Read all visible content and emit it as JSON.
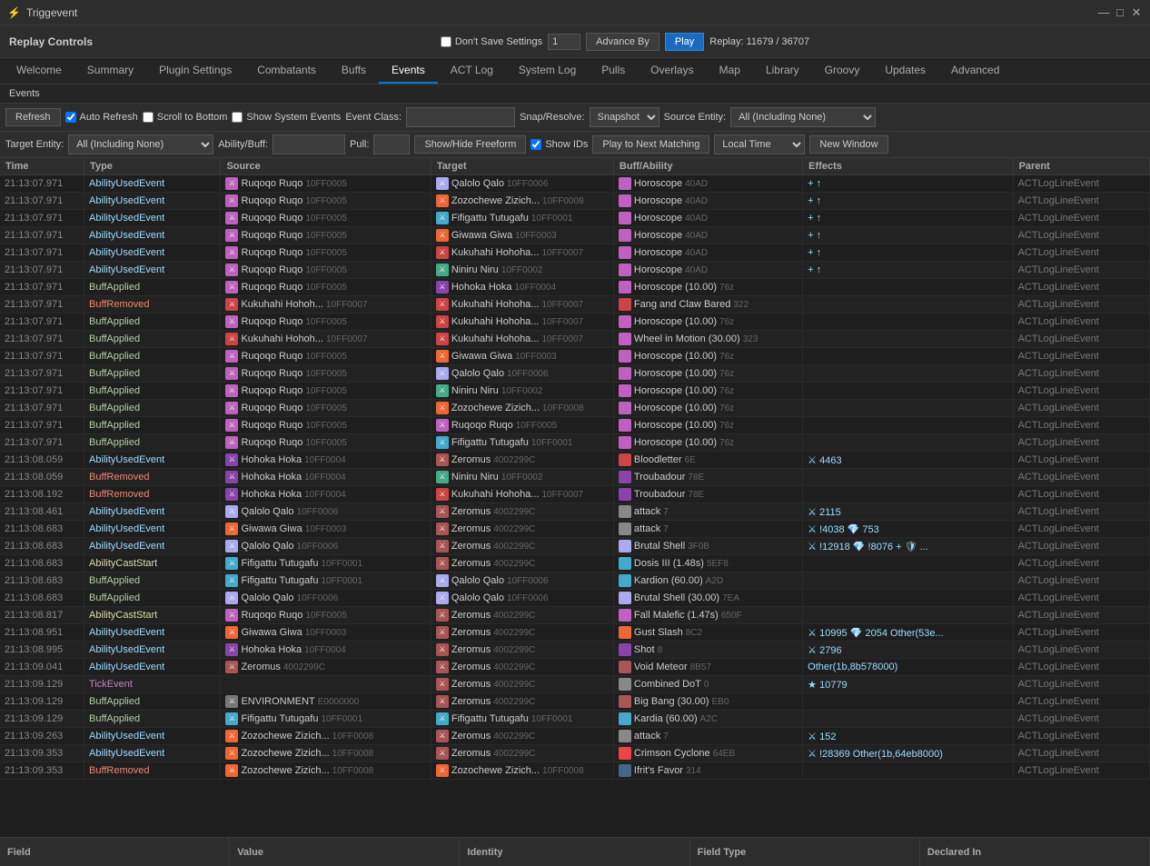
{
  "window": {
    "title": "Triggevent",
    "controls": [
      "—",
      "□",
      "✕"
    ]
  },
  "replay": {
    "title": "Replay Controls",
    "dont_save": "Don't Save Settings",
    "advance_by_label": "Advance By",
    "advance_by_value": "1",
    "play_label": "Play",
    "replay_info": "Replay: 11679 / 36707"
  },
  "nav_tabs": [
    "Welcome",
    "Summary",
    "Plugin Settings",
    "Combatants",
    "Buffs",
    "Events",
    "ACT Log",
    "System Log",
    "Pulls",
    "Overlays",
    "Map",
    "Library",
    "Groovy",
    "Updates",
    "Advanced"
  ],
  "active_tab": "Events",
  "section": "Events",
  "toolbar1": {
    "refresh_label": "Refresh",
    "auto_refresh_label": "Auto Refresh",
    "scroll_bottom_label": "Scroll to Bottom",
    "show_system_label": "Show System Events",
    "event_class_label": "Event Class:",
    "snap_resolve_label": "Snap/Resolve:",
    "snap_option": "Snapshot",
    "source_entity_label": "Source Entity:",
    "source_option": "All (Including None)"
  },
  "toolbar2": {
    "target_entity_label": "Target Entity:",
    "target_option": "All (Including None)",
    "ability_buff_label": "Ability/Buff:",
    "pull_label": "Pull:",
    "show_hide_freeform": "Show/Hide Freeform",
    "show_ids_label": "Show IDs",
    "play_next_label": "Play to Next Matching",
    "local_time_label": "Local Time",
    "new_window_label": "New Window"
  },
  "table": {
    "headers": [
      "Time",
      "Type",
      "Source",
      "Target",
      "Buff/Ability",
      "Effects",
      "Parent"
    ],
    "rows": [
      {
        "time": "21:13:07.971",
        "type": "AbilityUsedEvent",
        "type_class": "type-ability",
        "source": "Ruqoqo Ruqo",
        "source_id": "10FF0005",
        "target": "Qalolo Qalo",
        "target_id": "10FF0006",
        "buff": "Horoscope",
        "buff_id": "40AD",
        "effects": "+ ↑",
        "parent": "ACTLogLineEvent"
      },
      {
        "time": "21:13:07.971",
        "type": "AbilityUsedEvent",
        "type_class": "type-ability",
        "source": "Ruqoqo Ruqo",
        "source_id": "10FF0005",
        "target": "Zozochewe Zizich...",
        "target_id": "10FF0008",
        "buff": "Horoscope",
        "buff_id": "40AD",
        "effects": "+ ↑",
        "parent": "ACTLogLineEvent"
      },
      {
        "time": "21:13:07.971",
        "type": "AbilityUsedEvent",
        "type_class": "type-ability",
        "source": "Ruqoqo Ruqo",
        "source_id": "10FF0005",
        "target": "Fifigattu Tutugafu",
        "target_id": "10FF0001",
        "buff": "Horoscope",
        "buff_id": "40AD",
        "effects": "+ ↑",
        "parent": "ACTLogLineEvent"
      },
      {
        "time": "21:13:07.971",
        "type": "AbilityUsedEvent",
        "type_class": "type-ability",
        "source": "Ruqoqo Ruqo",
        "source_id": "10FF0005",
        "target": "Giwawa Giwa",
        "target_id": "10FF0003",
        "buff": "Horoscope",
        "buff_id": "40AD",
        "effects": "+ ↑",
        "parent": "ACTLogLineEvent"
      },
      {
        "time": "21:13:07.971",
        "type": "AbilityUsedEvent",
        "type_class": "type-ability",
        "source": "Ruqoqo Ruqo",
        "source_id": "10FF0005",
        "target": "Kukuhahi Hohoha...",
        "target_id": "10FF0007",
        "buff": "Horoscope",
        "buff_id": "40AD",
        "effects": "+ ↑",
        "parent": "ACTLogLineEvent"
      },
      {
        "time": "21:13:07.971",
        "type": "AbilityUsedEvent",
        "type_class": "type-ability",
        "source": "Ruqoqo Ruqo",
        "source_id": "10FF0005",
        "target": "Niniru Niru",
        "target_id": "10FF0002",
        "buff": "Horoscope",
        "buff_id": "40AD",
        "effects": "+ ↑",
        "parent": "ACTLogLineEvent"
      },
      {
        "time": "21:13:07.971",
        "type": "BuffApplied",
        "type_class": "type-buff-applied",
        "source": "Ruqoqo Ruqo",
        "source_id": "10FF0005",
        "target": "Hohoka Hoka",
        "target_id": "10FF0004",
        "buff": "Horoscope (10.00)",
        "buff_id": "76z",
        "effects": "",
        "parent": "ACTLogLineEvent"
      },
      {
        "time": "21:13:07.971",
        "type": "BuffRemoved",
        "type_class": "type-buff-removed",
        "source": "Kukuhahi Hohoh...",
        "source_id": "10FF0007",
        "target": "Kukuhahi Hohoha...",
        "target_id": "10FF0007",
        "buff": "Fang and Claw Bared",
        "buff_id": "322",
        "effects": "",
        "parent": "ACTLogLineEvent"
      },
      {
        "time": "21:13:07.971",
        "type": "BuffApplied",
        "type_class": "type-buff-applied",
        "source": "Ruqoqo Ruqo",
        "source_id": "10FF0005",
        "target": "Kukuhahi Hohoha...",
        "target_id": "10FF0007",
        "buff": "Horoscope (10.00)",
        "buff_id": "76z",
        "effects": "",
        "parent": "ACTLogLineEvent"
      },
      {
        "time": "21:13:07.971",
        "type": "BuffApplied",
        "type_class": "type-buff-applied",
        "source": "Kukuhahi Hohoh...",
        "source_id": "10FF0007",
        "target": "Kukuhahi Hohoha...",
        "target_id": "10FF0007",
        "buff": "Wheel in Motion (30.00)",
        "buff_id": "323",
        "effects": "",
        "parent": "ACTLogLineEvent"
      },
      {
        "time": "21:13:07.971",
        "type": "BuffApplied",
        "type_class": "type-buff-applied",
        "source": "Ruqoqo Ruqo",
        "source_id": "10FF0005",
        "target": "Giwawa Giwa",
        "target_id": "10FF0003",
        "buff": "Horoscope (10.00)",
        "buff_id": "76z",
        "effects": "",
        "parent": "ACTLogLineEvent"
      },
      {
        "time": "21:13:07.971",
        "type": "BuffApplied",
        "type_class": "type-buff-applied",
        "source": "Ruqoqo Ruqo",
        "source_id": "10FF0005",
        "target": "Qalolo Qalo",
        "target_id": "10FF0006",
        "buff": "Horoscope (10.00)",
        "buff_id": "76z",
        "effects": "",
        "parent": "ACTLogLineEvent"
      },
      {
        "time": "21:13:07.971",
        "type": "BuffApplied",
        "type_class": "type-buff-applied",
        "source": "Ruqoqo Ruqo",
        "source_id": "10FF0005",
        "target": "Niniru Niru",
        "target_id": "10FF0002",
        "buff": "Horoscope (10.00)",
        "buff_id": "76z",
        "effects": "",
        "parent": "ACTLogLineEvent"
      },
      {
        "time": "21:13:07.971",
        "type": "BuffApplied",
        "type_class": "type-buff-applied",
        "source": "Ruqoqo Ruqo",
        "source_id": "10FF0005",
        "target": "Zozochewe Zizich...",
        "target_id": "10FF0008",
        "buff": "Horoscope (10.00)",
        "buff_id": "76z",
        "effects": "",
        "parent": "ACTLogLineEvent"
      },
      {
        "time": "21:13:07.971",
        "type": "BuffApplied",
        "type_class": "type-buff-applied",
        "source": "Ruqoqo Ruqo",
        "source_id": "10FF0005",
        "target": "Ruqoqo Ruqo",
        "target_id": "10FF0005",
        "buff": "Horoscope (10.00)",
        "buff_id": "76z",
        "effects": "",
        "parent": "ACTLogLineEvent"
      },
      {
        "time": "21:13:07.971",
        "type": "BuffApplied",
        "type_class": "type-buff-applied",
        "source": "Ruqoqo Ruqo",
        "source_id": "10FF0005",
        "target": "Fifigattu Tutugafu",
        "target_id": "10FF0001",
        "buff": "Horoscope (10.00)",
        "buff_id": "76z",
        "effects": "",
        "parent": "ACTLogLineEvent"
      },
      {
        "time": "21:13:08.059",
        "type": "AbilityUsedEvent",
        "type_class": "type-ability",
        "source": "Hohoka Hoka",
        "source_id": "10FF0004",
        "target": "Zeromus",
        "target_id": "4002299C",
        "buff": "Bloodletter",
        "buff_id": "6E",
        "effects": "⚔ 4463",
        "parent": "ACTLogLineEvent"
      },
      {
        "time": "21:13:08.059",
        "type": "BuffRemoved",
        "type_class": "type-buff-removed",
        "source": "Hohoka Hoka",
        "source_id": "10FF0004",
        "target": "Niniru Niru",
        "target_id": "10FF0002",
        "buff": "Troubadour",
        "buff_id": "78E",
        "effects": "",
        "parent": "ACTLogLineEvent"
      },
      {
        "time": "21:13:08.192",
        "type": "BuffRemoved",
        "type_class": "type-buff-removed",
        "source": "Hohoka Hoka",
        "source_id": "10FF0004",
        "target": "Kukuhahi Hohoha...",
        "target_id": "10FF0007",
        "buff": "Troubadour",
        "buff_id": "78E",
        "effects": "",
        "parent": "ACTLogLineEvent"
      },
      {
        "time": "21:13:08.461",
        "type": "AbilityUsedEvent",
        "type_class": "type-ability",
        "source": "Qalolo Qalo",
        "source_id": "10FF0006",
        "target": "Zeromus",
        "target_id": "4002299C",
        "buff": "attack",
        "buff_id": "7",
        "effects": "⚔ 2115",
        "parent": "ACTLogLineEvent"
      },
      {
        "time": "21:13:08.683",
        "type": "AbilityUsedEvent",
        "type_class": "type-ability",
        "source": "Giwawa Giwa",
        "source_id": "10FF0003",
        "target": "Zeromus",
        "target_id": "4002299C",
        "buff": "attack",
        "buff_id": "7",
        "effects": "⚔ !4038 💎 753",
        "parent": "ACTLogLineEvent"
      },
      {
        "time": "21:13:08.683",
        "type": "AbilityUsedEvent",
        "type_class": "type-ability",
        "source": "Qalolo Qalo",
        "source_id": "10FF0006",
        "target": "Zeromus",
        "target_id": "4002299C",
        "buff": "Brutal Shell",
        "buff_id": "3F0B",
        "effects": "⚔ !12918 💎 !8076 + 🛡 ...",
        "parent": "ACTLogLineEvent"
      },
      {
        "time": "21:13:08.683",
        "type": "AbilityCastStart",
        "type_class": "type-cast",
        "source": "Fifigattu Tutugafu",
        "source_id": "10FF0001",
        "target": "Zeromus",
        "target_id": "4002299C",
        "buff": "Dosis III (1.48s)",
        "buff_id": "5EF8",
        "effects": "",
        "parent": "ACTLogLineEvent"
      },
      {
        "time": "21:13:08.683",
        "type": "BuffApplied",
        "type_class": "type-buff-applied",
        "source": "Fifigattu Tutugafu",
        "source_id": "10FF0001",
        "target": "Qalolo Qalo",
        "target_id": "10FF0006",
        "buff": "Kardion (60.00)",
        "buff_id": "A2D",
        "effects": "",
        "parent": "ACTLogLineEvent"
      },
      {
        "time": "21:13:08.683",
        "type": "BuffApplied",
        "type_class": "type-buff-applied",
        "source": "Qalolo Qalo",
        "source_id": "10FF0006",
        "target": "Qalolo Qalo",
        "target_id": "10FF0006",
        "buff": "Brutal Shell (30.00)",
        "buff_id": "7EA",
        "effects": "",
        "parent": "ACTLogLineEvent"
      },
      {
        "time": "21:13:08.817",
        "type": "AbilityCastStart",
        "type_class": "type-cast",
        "source": "Ruqoqo Ruqo",
        "source_id": "10FF0005",
        "target": "Zeromus",
        "target_id": "4002299C",
        "buff": "Fall Malefic (1.47s)",
        "buff_id": "650F",
        "effects": "",
        "parent": "ACTLogLineEvent"
      },
      {
        "time": "21:13:08.951",
        "type": "AbilityUsedEvent",
        "type_class": "type-ability",
        "source": "Giwawa Giwa",
        "source_id": "10FF0003",
        "target": "Zeromus",
        "target_id": "4002299C",
        "buff": "Gust Slash",
        "buff_id": "8C2",
        "effects": "⚔ 10995 💎 2054 Other(53e...",
        "parent": "ACTLogLineEvent"
      },
      {
        "time": "21:13:08.995",
        "type": "AbilityUsedEvent",
        "type_class": "type-ability",
        "source": "Hohoka Hoka",
        "source_id": "10FF0004",
        "target": "Zeromus",
        "target_id": "4002299C",
        "buff": "Shot",
        "buff_id": "8",
        "effects": "⚔ 2796",
        "parent": "ACTLogLineEvent"
      },
      {
        "time": "21:13:09.041",
        "type": "AbilityUsedEvent",
        "type_class": "type-ability",
        "source": "Zeromus",
        "source_id": "4002299C",
        "target": "Zeromus",
        "target_id": "4002299C",
        "buff": "Void Meteor",
        "buff_id": "8B57",
        "effects": "Other(1b,8b578000)",
        "parent": "ACTLogLineEvent"
      },
      {
        "time": "21:13:09.129",
        "type": "TickEvent",
        "type_class": "type-tick",
        "source": "",
        "source_id": "",
        "target": "Zeromus",
        "target_id": "4002299C",
        "buff": "Combined DoT",
        "buff_id": "0",
        "effects": "★ 10779",
        "parent": "ACTLogLineEvent"
      },
      {
        "time": "21:13:09.129",
        "type": "BuffApplied",
        "type_class": "type-buff-applied",
        "source": "ENVIRONMENT",
        "source_id": "E0000000",
        "target": "Zeromus",
        "target_id": "4002299C",
        "buff": "Big Bang (30.00)",
        "buff_id": "EB0",
        "effects": "",
        "parent": "ACTLogLineEvent"
      },
      {
        "time": "21:13:09.129",
        "type": "BuffApplied",
        "type_class": "type-buff-applied",
        "source": "Fifigattu Tutugafu",
        "source_id": "10FF0001",
        "target": "Fifigattu Tutugafu",
        "target_id": "10FF0001",
        "buff": "Kardia (60.00)",
        "buff_id": "A2C",
        "effects": "",
        "parent": "ACTLogLineEvent"
      },
      {
        "time": "21:13:09.263",
        "type": "AbilityUsedEvent",
        "type_class": "type-ability",
        "source": "Zozochewe Zizich...",
        "source_id": "10FF0008",
        "target": "Zeromus",
        "target_id": "4002299C",
        "buff": "attack",
        "buff_id": "7",
        "effects": "⚔ 152",
        "parent": "ACTLogLineEvent"
      },
      {
        "time": "21:13:09.353",
        "type": "AbilityUsedEvent",
        "type_class": "type-ability",
        "source": "Zozochewe Zizich...",
        "source_id": "10FF0008",
        "target": "Zeromus",
        "target_id": "4002299C",
        "buff": "Crimson Cyclone",
        "buff_id": "64EB",
        "effects": "⚔ !28369 Other(1b,64eb8000)",
        "parent": "ACTLogLineEvent"
      },
      {
        "time": "21:13:09.353",
        "type": "BuffRemoved",
        "type_class": "type-buff-removed",
        "source": "Zozochewe Zizich...",
        "source_id": "10FF0008",
        "target": "Zozochewe Zizich...",
        "target_id": "10FF0008",
        "buff": "Ifrit's Favor",
        "buff_id": "314",
        "effects": "",
        "parent": "ACTLogLineEvent"
      }
    ]
  },
  "bottom_bar": {
    "cols": [
      "Field",
      "Value",
      "Identity",
      "Field Type",
      "Declared In"
    ]
  },
  "icon_colors": {
    "astrologian": "#c060c0",
    "warrior": "#cc4444",
    "sage": "#44aacc",
    "bard": "#ccaa44",
    "reaper": "#8844aa",
    "default": "#556688"
  }
}
